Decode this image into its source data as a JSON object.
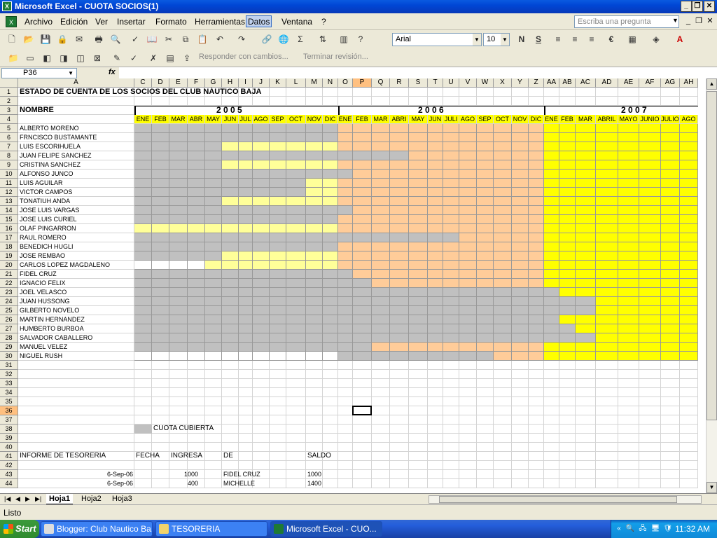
{
  "window": {
    "title": "Microsoft Excel - CUOTA SOCIOS(1)"
  },
  "menu": [
    "Archivo",
    "Edición",
    "Ver",
    "Insertar",
    "Formato",
    "Herramientas",
    "Datos",
    "Ventana",
    "?"
  ],
  "active_menu": "Datos",
  "ask_placeholder": "Escriba una pregunta",
  "font": {
    "name": "Arial",
    "size": "10"
  },
  "review": {
    "reply": "Responder con cambios...",
    "end": "Terminar revisión..."
  },
  "name_box": "P36",
  "fx": "fx",
  "sheet_tabs": [
    "Hoja1",
    "Hoja2",
    "Hoja3"
  ],
  "active_sheet": "Hoja1",
  "status": "Listo",
  "taskbar": {
    "start": "Start",
    "tasks": [
      "Blogger: Club Nautico Ba...",
      "TESORERIA",
      "Microsoft Excel - CUO..."
    ],
    "active": 2,
    "clock": "11:32 AM"
  },
  "columns": [
    "A",
    "C",
    "D",
    "E",
    "F",
    "G",
    "H",
    "I",
    "J",
    "K",
    "L",
    "M",
    "N",
    "O",
    "P",
    "Q",
    "R",
    "S",
    "T",
    "U",
    "V",
    "W",
    "X",
    "Y",
    "Z",
    "AA",
    "AB",
    "AC",
    "AD",
    "AE",
    "AF",
    "AG",
    "AH"
  ],
  "selected_column": "P",
  "selected_row": 36,
  "row_numbers": [
    1,
    2,
    3,
    4,
    5,
    6,
    7,
    8,
    9,
    10,
    11,
    12,
    13,
    14,
    15,
    16,
    17,
    18,
    19,
    20,
    21,
    22,
    23,
    24,
    25,
    26,
    27,
    28,
    29,
    30,
    31,
    32,
    33,
    34,
    35,
    36,
    37,
    38,
    39,
    40,
    41,
    42,
    43,
    44
  ],
  "sheet_title": "ESTADO DE CUENTA DE LOS SOCIOS DEL CLUB NÁUTICO BAJA",
  "name_header": "NOMBRE",
  "years": [
    "2  0  0 5",
    "2    0    0    6",
    "2        0        0        7"
  ],
  "months_2005": [
    "ENE",
    "FEB",
    "MAR",
    "ABR",
    "MAY",
    "JUN",
    "JUL",
    "AGO",
    "SEP",
    "OCT",
    "NOV",
    "DIC"
  ],
  "months_2006": [
    "ENE",
    "FEB",
    "MAR",
    "ABRI",
    "MAY",
    "JUN",
    "JULI",
    "AGO",
    "SEP",
    "OCT",
    "NOV",
    "DIC"
  ],
  "months_2007": [
    "ENE",
    "FEB",
    "MAR",
    "ABRIL",
    "MAYO",
    "JUNIO",
    "JULIO",
    "AGO"
  ],
  "members": [
    "ALBERTO MORENO",
    "FRNCISCO BUSTAMANTE",
    "LUIS ESCORIHUELA",
    "JUAN FELIPE SANCHEZ",
    "CRISTINA SANCHEZ",
    "ALFONSO JUNCO",
    "LUIS AGUILAR",
    "VICTOR CAMPOS",
    "TONATIUH ANDA",
    "JOSE LUIS VARGAS",
    "JOSE LUIS CURIEL",
    "OLAF PINGARRON",
    "RAUL ROMERO",
    "BENEDICH HUGLI",
    "JOSE REMBAO",
    "CARLOS LOPEZ MAGDALENO",
    "FIDEL CRUZ",
    "IGNACIO FELIX",
    "JOEL VELASCO",
    "JUAN HUSSONG",
    "GILBERTO NOVELO",
    "MARTIN HERNANDEZ",
    "HUMBERTO BURBOA",
    "SALVADOR CABALLERO",
    "MANUEL VELEZ",
    "NIGUEL RUSH"
  ],
  "paid_2005": [
    12,
    12,
    5,
    12,
    5,
    12,
    10,
    10,
    5,
    12,
    12,
    0,
    12,
    12,
    5,
    0,
    12,
    12,
    12,
    12,
    12,
    12,
    12,
    12,
    12,
    0
  ],
  "paid_2006": [
    0,
    0,
    0,
    4,
    0,
    1,
    0,
    0,
    0,
    1,
    0,
    0,
    7,
    0,
    0,
    0,
    1,
    2,
    12,
    12,
    12,
    12,
    12,
    12,
    2,
    9
  ],
  "paid_2007": [
    0,
    0,
    0,
    0,
    0,
    0,
    0,
    0,
    0,
    0,
    0,
    0,
    0,
    0,
    0,
    0,
    0,
    0,
    1,
    3,
    3,
    1,
    2,
    3,
    0,
    0
  ],
  "legend_label": "CUOTA CUBIERTA",
  "tesoreria": {
    "title": "INFORME  DE TESORERIA",
    "headers": [
      "FECHA",
      "INGRESA",
      "DE",
      "SALDO"
    ],
    "rows": [
      {
        "fecha": "6-Sep-06",
        "ingresa": "1000",
        "de": "FIDEL CRUZ",
        "saldo": "1000"
      },
      {
        "fecha": "6-Sep-06",
        "ingresa": "400",
        "de": "MICHELLE",
        "saldo": "1400"
      }
    ]
  },
  "colors": {
    "paid": "#c0c0c0",
    "pending_2005": "#ffff99",
    "pending_2006": "#ffcc99",
    "pending_2007": "#ffff00",
    "header_bg": "#ece9d8",
    "title_bar": "#0a5ae0"
  }
}
